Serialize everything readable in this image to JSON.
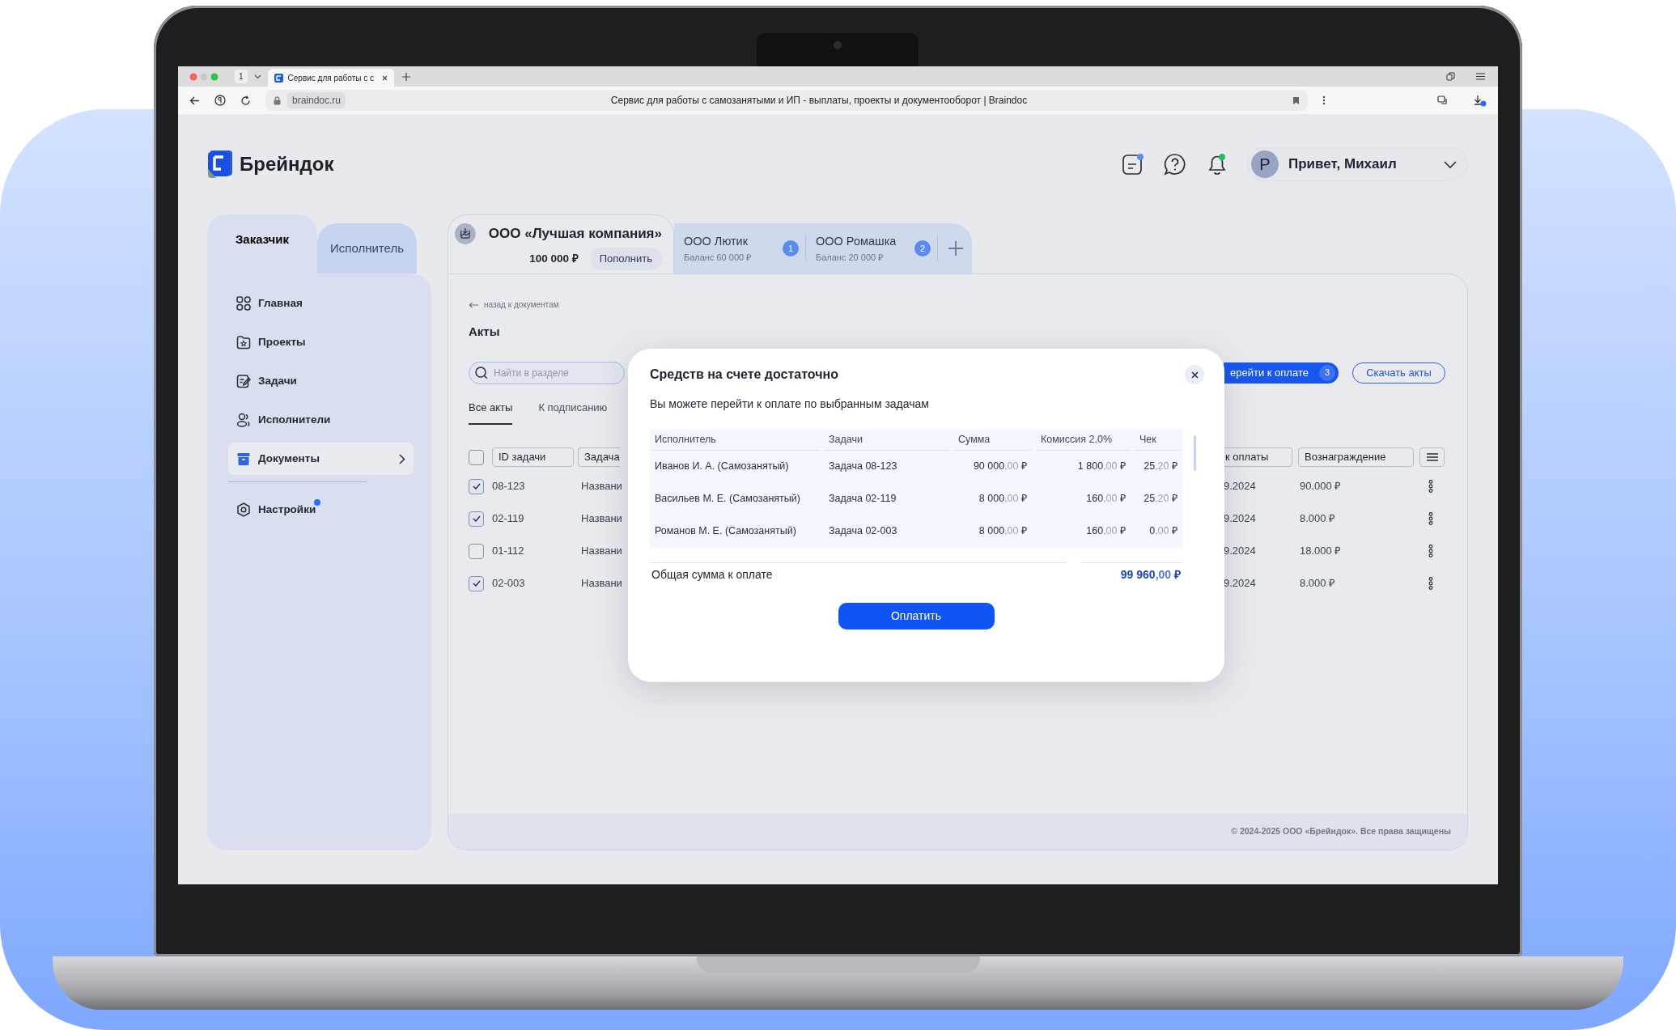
{
  "browser": {
    "tab_count": "1",
    "tab_title": "Сервис для работы с с",
    "url": "braindoc.ru",
    "page_title": "Сервис для работы с самозанятыми и ИП - выплаты, проекты и документооборот | Braindoc"
  },
  "header": {
    "logo_text": "Брейндок",
    "user_initial": "Р",
    "greeting": "Привет, Михаил"
  },
  "role_tabs": [
    {
      "label": "Заказчик",
      "selected": true
    },
    {
      "label": "Исполнитель",
      "selected": false
    }
  ],
  "nav": [
    {
      "label": "Главная",
      "selected": false,
      "notification": false
    },
    {
      "label": "Проекты",
      "selected": false,
      "notification": false
    },
    {
      "label": "Задачи",
      "selected": false,
      "notification": false
    },
    {
      "label": "Исполнители",
      "selected": false,
      "notification": false
    },
    {
      "label": "Документы",
      "selected": true,
      "notification": false
    },
    {
      "label": "Настройки",
      "selected": false,
      "notification": true
    }
  ],
  "company_tabs": [
    {
      "name": "ООО «Лучшая компания»",
      "balance": "100 000 ₽",
      "action": "Пополнить",
      "selected": true
    },
    {
      "name": "ООО Лютик",
      "balance": "Баланс 60 000 ₽",
      "count": "1",
      "selected": false
    },
    {
      "name": "ООО Ромашка",
      "balance": "Баланс 20 000 ₽",
      "count": "2",
      "selected": false
    }
  ],
  "back_link": "назад к документам",
  "title": "Акты",
  "search": {
    "placeholder": "Найти в разделе"
  },
  "doc_tabs": [
    {
      "label": "Все акты",
      "selected": true
    },
    {
      "label": "К подписанию",
      "selected": false
    }
  ],
  "actions": {
    "pay": "ерейти к оплате",
    "pay_count": "3",
    "download": "Скачать акты"
  },
  "table": {
    "header_checked": false,
    "columns_left": [
      "ID задачи",
      "Задача"
    ],
    "columns_right": [
      "к оплаты",
      "Вознаграждение"
    ],
    "rows": [
      {
        "checked": true,
        "id": "08-123",
        "task": "Названи",
        "date": "9.2024",
        "reward": "90.000 ₽"
      },
      {
        "checked": true,
        "id": "02-119",
        "task": "Названи",
        "date": "9.2024",
        "reward": "8.000 ₽"
      },
      {
        "checked": false,
        "id": "01-112",
        "task": "Названи",
        "date": "9.2024",
        "reward": "18.000 ₽"
      },
      {
        "checked": true,
        "id": "02-003",
        "task": "Названи",
        "date": "9.2024",
        "reward": "8.000 ₽"
      }
    ]
  },
  "modal": {
    "title": "Средств на счете достаточно",
    "subtitle": "Вы можете перейти к оплате по выбранным задачам",
    "columns": [
      "Исполнитель",
      "Задачи",
      "Сумма",
      "Комиссия 2.0%",
      "Чек"
    ],
    "rows": [
      [
        "Иванов И. А. (Самозанятый)",
        "Задача 08-123",
        "90 000,00 ₽",
        "1 800,00 ₽",
        "25,20 ₽"
      ],
      [
        "Васильев М. Е. (Самозанятый)",
        "Задача 02-119",
        "8 000,00 ₽",
        "160,00 ₽",
        "25,20 ₽"
      ],
      [
        "Романов М. Е. (Самозанятый)",
        "Задача 02-003",
        "8 000,00 ₽",
        "160,00 ₽",
        "0,00 ₽"
      ]
    ],
    "total_label": "Общая сумма к оплате",
    "total": "99 960,00 ₽",
    "button": "Оплатить"
  },
  "footer": "© 2024-2025 ООО «Брейндок». Все права защищены"
}
